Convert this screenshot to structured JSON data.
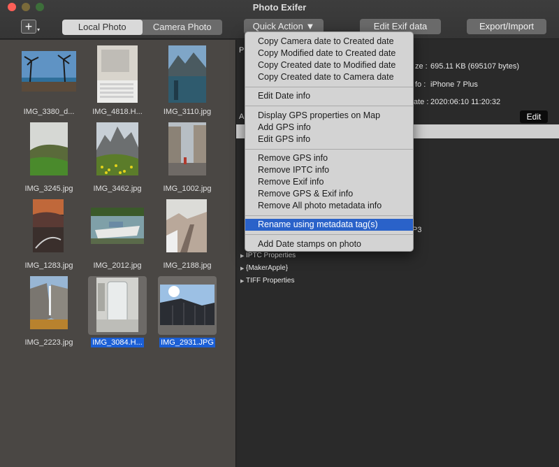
{
  "window": {
    "title": "Photo Exifer"
  },
  "toolbar": {
    "add_symbol": "+",
    "add_caret": "▾",
    "tabs": [
      {
        "label": "Local Photo",
        "active": true
      },
      {
        "label": "Camera Photo",
        "active": false
      }
    ],
    "quick_action_label": "Quick Action ▼",
    "edit_exif_label": "Edit Exif data",
    "export_import_label": "Export/Import"
  },
  "photos": [
    {
      "name": "IMG_3380_d...",
      "selected": false
    },
    {
      "name": "IMG_4818.H...",
      "selected": false
    },
    {
      "name": "IMG_3110.jpg",
      "selected": false
    },
    {
      "name": "IMG_3245.jpg",
      "selected": false
    },
    {
      "name": "IMG_3462.jpg",
      "selected": false
    },
    {
      "name": "IMG_1002.jpg",
      "selected": false
    },
    {
      "name": "IMG_1283.jpg",
      "selected": false
    },
    {
      "name": "IMG_2012.jpg",
      "selected": false
    },
    {
      "name": "IMG_2188.jpg",
      "selected": false
    },
    {
      "name": "IMG_2223.jpg",
      "selected": false
    },
    {
      "name": "IMG_3084.H...",
      "selected": true
    },
    {
      "name": "IMG_2931.JPG",
      "selected": true
    }
  ],
  "details": {
    "tab_initial": "P",
    "size_label": "ze :",
    "size_value": "695.11 KB (695107 bytes)",
    "model_label": "fo :",
    "model_value": "iPhone 7 Plus",
    "date_label": "ate :",
    "date_value": "2020:06:10 11:20:32",
    "section_initial": "A",
    "edit_label": "Edit",
    "partial_text": "P3"
  },
  "tree": [
    {
      "label": "IPTC Properties"
    },
    {
      "label": "{MakerApple}"
    },
    {
      "label": "TIFF Properties"
    }
  ],
  "quick_action_menu": [
    {
      "type": "item",
      "label": "Copy Camera date to Created date"
    },
    {
      "type": "item",
      "label": "Copy Modified date to Created date"
    },
    {
      "type": "item",
      "label": "Copy Created date to Modified date"
    },
    {
      "type": "item",
      "label": "Copy Created date to Camera date"
    },
    {
      "type": "sep"
    },
    {
      "type": "item",
      "label": "Edit Date info"
    },
    {
      "type": "sep"
    },
    {
      "type": "item",
      "label": "Display GPS properties on Map"
    },
    {
      "type": "item",
      "label": "Add GPS info"
    },
    {
      "type": "item",
      "label": "Edit GPS  info"
    },
    {
      "type": "sep"
    },
    {
      "type": "item",
      "label": "Remove GPS info"
    },
    {
      "type": "item",
      "label": "Remove IPTC info"
    },
    {
      "type": "item",
      "label": "Remove Exif info"
    },
    {
      "type": "item",
      "label": "Remove GPS & Exif info"
    },
    {
      "type": "item",
      "label": "Remove All photo metadata info"
    },
    {
      "type": "sep"
    },
    {
      "type": "item",
      "label": "Rename using metadata tag(s)",
      "highlighted": true
    },
    {
      "type": "sep"
    },
    {
      "type": "item",
      "label": "Add Date stamps on photo"
    }
  ]
}
